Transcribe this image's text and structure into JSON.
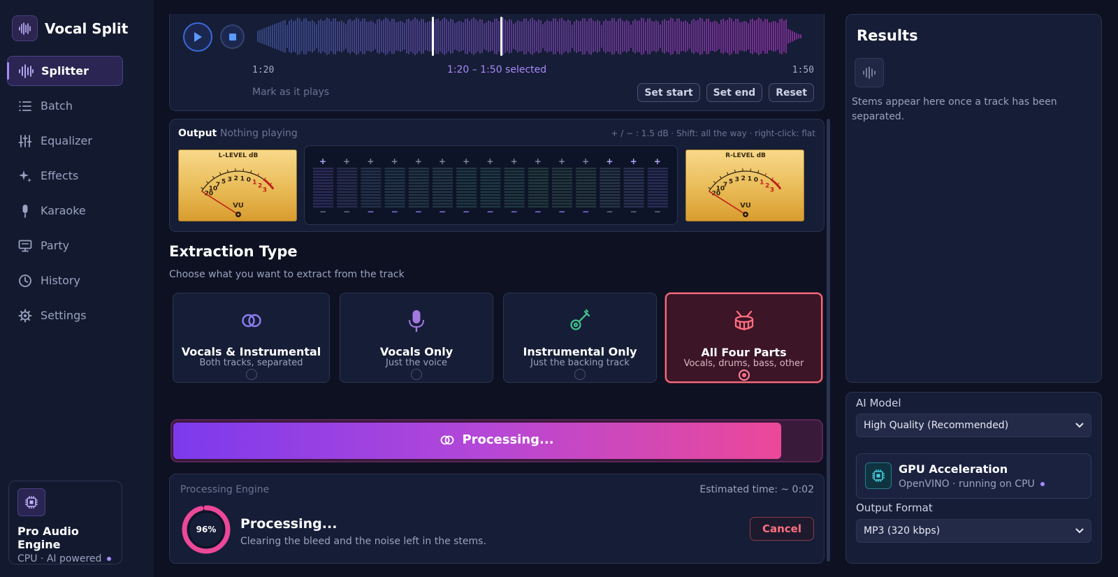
{
  "app": {
    "name": "Vocal Split"
  },
  "sidebar": {
    "items": [
      {
        "label": "Splitter",
        "icon": "waveform-icon",
        "active": true
      },
      {
        "label": "Batch",
        "icon": "list-icon"
      },
      {
        "label": "Equalizer",
        "icon": "sliders-icon"
      },
      {
        "label": "Effects",
        "icon": "sparkle-icon"
      },
      {
        "label": "Karaoke",
        "icon": "microphone-icon"
      },
      {
        "label": "Party",
        "icon": "monitor-icon"
      },
      {
        "label": "History",
        "icon": "clock-icon"
      },
      {
        "label": "Settings",
        "icon": "gear-icon"
      }
    ],
    "engine": {
      "title": "Pro Audio Engine",
      "subtitle": "CPU · AI powered"
    }
  },
  "waveform": {
    "start_time": "1:20",
    "end_time": "1:50",
    "selection": "1:20 – 1:50 selected",
    "mark_hint": "Mark as it plays",
    "buttons": {
      "set_start": "Set start",
      "set_end": "Set end",
      "reset": "Reset"
    }
  },
  "output": {
    "label": "Output",
    "status": "Nothing playing",
    "hint": "+ / − : 1.5 dB · Shift: all the way · right-click: flat",
    "vu_left_title": "L-LEVEL dB",
    "vu_right_title": "R-LEVEL dB",
    "vu_label": "VU",
    "vu_scale": [
      "20",
      "10",
      "7",
      "5",
      "3",
      "2",
      "1",
      "0",
      "1",
      "2",
      "3"
    ],
    "eq_bands": 15,
    "eq_plus": "+",
    "eq_minus": "−"
  },
  "extraction": {
    "title": "Extraction Type",
    "subtitle": "Choose what you want to extract from the track",
    "options": [
      {
        "title": "Vocals & Instrumental",
        "desc": "Both tracks, separated",
        "icon": "rings-icon",
        "color": "#8b7cf0"
      },
      {
        "title": "Vocals Only",
        "desc": "Just the voice",
        "icon": "microphone-icon",
        "color": "#a178e0"
      },
      {
        "title": "Instrumental Only",
        "desc": "Just the backing track",
        "icon": "guitar-icon",
        "color": "#3fc08a"
      },
      {
        "title": "All Four Parts",
        "desc": "Vocals, drums, bass, other",
        "icon": "drum-icon",
        "color": "#ff6f7f",
        "selected": true
      }
    ]
  },
  "processing": {
    "button_label": "Processing...",
    "progress": 0.96,
    "engine_label": "Processing Engine",
    "estimated": "Estimated time: ~ 0:02",
    "percent": "96%",
    "status": "Processing...",
    "detail": "Clearing the bleed and the noise left in the stems.",
    "cancel": "Cancel"
  },
  "results": {
    "title": "Results",
    "empty_text": "Stems appear here once a track has been separated."
  },
  "settings": {
    "model_label": "AI Model",
    "model_value": "High Quality (Recommended)",
    "gpu_title": "GPU Acceleration",
    "gpu_sub": "OpenVINO · running on CPU",
    "format_label": "Output Format",
    "format_value": "MP3 (320 kbps)"
  },
  "colors": {
    "accent": "#a78bfa",
    "selected": "#f2707f",
    "progress_start": "#7c3aed",
    "progress_end": "#ec4899"
  }
}
